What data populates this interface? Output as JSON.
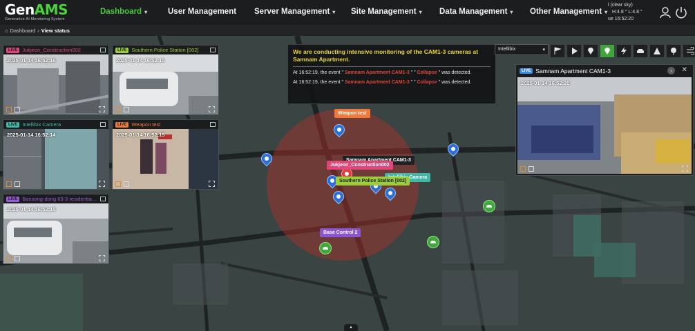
{
  "app": {
    "logo_main": "Gen",
    "logo_accent": "AMS",
    "logo_sub": "Generative AI Monitoring System"
  },
  "nav": [
    {
      "label": "Dashboard",
      "active": true
    },
    {
      "label": "User Management",
      "active": false
    },
    {
      "label": "Server Management",
      "active": false
    },
    {
      "label": "Site Management",
      "active": false
    },
    {
      "label": "Data Management",
      "active": false
    },
    {
      "label": "Other Management",
      "active": false
    }
  ],
  "weather": {
    "line1": "l (clear sky)",
    "line2": "H:4.8 °  L:4.8 °",
    "line3": "ue 16:52:20"
  },
  "top_icons": [
    "user-icon",
    "power-icon"
  ],
  "breadcrumb": {
    "home": "Dashboard",
    "current": "View status"
  },
  "cameras": [
    {
      "live": "LIVE",
      "title": "Jukjeon_Construction002",
      "time": "2025-01-14 16:52:16",
      "color": "#e0467a"
    },
    {
      "live": "LIVE",
      "title": "Southern Police Station [002]",
      "time": "2025-01-14 16:52:15",
      "color": "#9ccd3a"
    },
    {
      "live": "LIVE",
      "title": "Intellibix Camera",
      "time": "2025-01-14 16:52:14",
      "color": "#3fb8a8"
    },
    {
      "live": "LIVE",
      "title": "Weapon test",
      "time": "2025-01-14 16:52:15",
      "color": "#f07a3c"
    },
    {
      "live": "LIVE",
      "title": "Bansong-dong 63-3 residentia…",
      "time": "2025-01-14 16:52:15",
      "color": "#9a5ad8"
    }
  ],
  "notice": {
    "title": "We are conducting intensive monitoring of the CAM1-3 cameras at Samnam Apartment.",
    "events": [
      {
        "prefix": "At 16:52:19, the event \" ",
        "camera": "Samnam Apartment CAM1-3",
        "mid": " \" \" ",
        "event": "Collapse",
        "suffix": " \" was detected."
      },
      {
        "prefix": "At 16:52:19, the event \" ",
        "camera": "Samnam Apartment CAM1-3",
        "mid": " \" \" ",
        "event": "Collapse",
        "suffix": " \" was detected."
      }
    ]
  },
  "toolbar": {
    "select_value": "Intellibix",
    "buttons": [
      "flag-icon",
      "play-icon",
      "location-icon",
      "map-pin-icon",
      "lightning-icon",
      "car-icon",
      "alert-icon",
      "pin-check-icon",
      "wind-icon"
    ]
  },
  "bigcam": {
    "live": "LIVE",
    "title": "Samnam Apartment CAM1-3",
    "time": "2025-01-14 16:52:20",
    "color": "#3b8de0"
  },
  "map_labels": [
    {
      "text": "Weapon test",
      "color": "#f07a3c"
    },
    {
      "text": "Samnam Apartment CAM1-3",
      "color": "#1f2124"
    },
    {
      "text": "Jukjeon_Construction002",
      "color": "#e0467a"
    },
    {
      "text": "Southern Police Station [002]",
      "color": "#9ccd3a"
    },
    {
      "text": "Intellibix Camera",
      "color": "#3fb8a8"
    },
    {
      "text": "Base Control 2",
      "color": "#8a55d0"
    }
  ]
}
